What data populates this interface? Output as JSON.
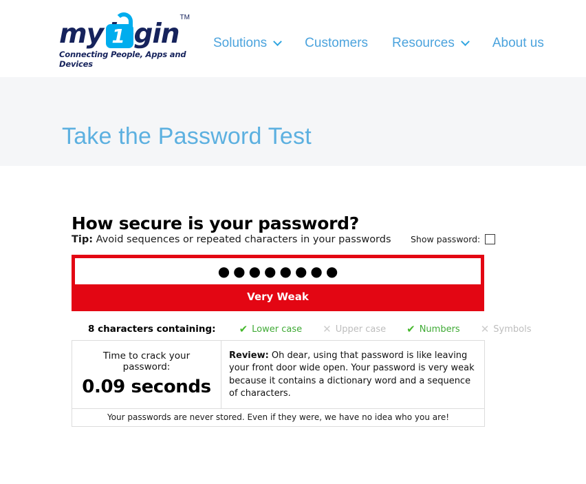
{
  "header": {
    "logo": {
      "word_my": "my",
      "lock_number": "1",
      "word_login": "login",
      "trademark": "TM",
      "tagline": "Connecting People, Apps and Devices"
    },
    "nav": [
      {
        "label": "Solutions",
        "has_caret": true
      },
      {
        "label": "Customers",
        "has_caret": false
      },
      {
        "label": "Resources",
        "has_caret": true
      },
      {
        "label": "About us",
        "has_caret": false
      }
    ]
  },
  "hero": {
    "title": "Take the Password Test"
  },
  "main": {
    "section_title": "How secure is your password?",
    "tip_label": "Tip:",
    "tip_text": " Avoid sequences or repeated characters in your passwords",
    "show_password_label": "Show password:",
    "show_password_checked": false,
    "password_masked": "●●●●●●●●",
    "strength_label": "Very Weak",
    "strength_color": "#e30613",
    "criteria_label": "8 characters containing:",
    "criteria": [
      {
        "label": "Lower case",
        "met": true,
        "mark": "✔"
      },
      {
        "label": "Upper case",
        "met": false,
        "mark": "✕"
      },
      {
        "label": "Numbers",
        "met": true,
        "mark": "✔"
      },
      {
        "label": "Symbols",
        "met": false,
        "mark": "✕"
      }
    ],
    "crack_label": "Time to crack your password:",
    "crack_value": "0.09 seconds",
    "review_label": "Review:",
    "review_text": " Oh dear, using that password is like leaving your front door wide open. Your password is very weak because it contains a dictionary word and a sequence of characters.",
    "footer_note": "Your passwords are never stored. Even if they were, we have no idea who you are!"
  },
  "colors": {
    "brand_navy": "#16235c",
    "brand_cyan": "#00adee",
    "nav_blue": "#4ba3dd",
    "hero_title_blue": "#5cb0e0",
    "hero_bg": "#f5f6f8",
    "danger_red": "#e30613",
    "pass_green": "#45b82c",
    "fail_gray": "#cccccc"
  }
}
